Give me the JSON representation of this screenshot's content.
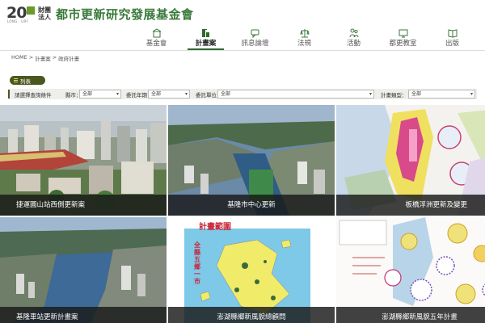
{
  "header": {
    "logo_number": "20",
    "logo_small": "LONG · URF",
    "logo_sub": "財團法人",
    "logo_title": "都市更新研究發展基金會"
  },
  "nav": [
    {
      "label": "基金會",
      "icon": "foundation-icon"
    },
    {
      "label": "計畫案",
      "icon": "projects-icon",
      "active": true
    },
    {
      "label": "訊息論壇",
      "icon": "forum-icon"
    },
    {
      "label": "法規",
      "icon": "law-icon"
    },
    {
      "label": "活動",
      "icon": "events-icon"
    },
    {
      "label": "都更教室",
      "icon": "classroom-icon"
    },
    {
      "label": "出版",
      "icon": "publication-icon"
    }
  ],
  "breadcrumb": [
    "HOME",
    ">",
    "計畫案",
    ">",
    "政府計畫"
  ],
  "list_tab": {
    "label": "列表"
  },
  "filters": {
    "prompt": "請選擇查詢條件",
    "county": {
      "label": "縣市：",
      "value": "全部"
    },
    "year": {
      "label": "委託年期：",
      "value": "全部"
    },
    "unit": {
      "label": "委託單位：",
      "value": "全部"
    },
    "type": {
      "label": "計畫類型：",
      "value": "全部"
    }
  },
  "projects": [
    {
      "title": "捷運圓山站西側更新案"
    },
    {
      "title": "基隆市中心更新"
    },
    {
      "title": "板橋浮洲更新及變更"
    },
    {
      "title": "基隆車站更新計畫案"
    },
    {
      "title": "澎湖縣鄉新風貌總顧問",
      "map_title": "計畫範圍",
      "map_side": "全縣五鄉一市"
    },
    {
      "title": "澎湖縣鄉新風貌五年計畫"
    }
  ],
  "colors": {
    "brand_green": "#3a7a3a",
    "nav_active": "#2f6a2f",
    "tab_bg": "#4a5820",
    "filter_bg": "#eeeeea"
  }
}
